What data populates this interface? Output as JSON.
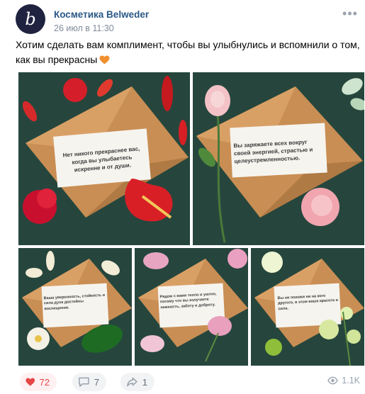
{
  "post": {
    "author": "Косметика Belweder",
    "avatar_letter": "b",
    "time": "26 июл в 11:30",
    "text": "Хотим сделать вам комплимент, чтобы вы улыбнулись и вспомнили о том, как вы прекрасны",
    "emoji": "orange-heart"
  },
  "images": [
    {
      "card_text": "Нет никого прекраснее вас, когда вы улыбаетесь искренне и от души."
    },
    {
      "card_text": "Вы заряжаете всех вокруг своей энергией, страстью и целеустремленностью."
    },
    {
      "card_text": "Ваша уверенность, стойкость и сила духа достойны восхищения."
    },
    {
      "card_text": "Рядом с вами тепло и уютно, потому что вы излучаете нежность, заботу и доброту."
    },
    {
      "card_text": "Вы ни похожи ни на кого другого, в этом ваша красота и сила."
    }
  ],
  "actions": {
    "likes": "72",
    "comments": "7",
    "shares": "1",
    "views": "1.1K"
  },
  "colors": {
    "link": "#2a5885",
    "like_red": "#e64646",
    "background_green": "#26463d",
    "envelope": "#c98e54"
  }
}
